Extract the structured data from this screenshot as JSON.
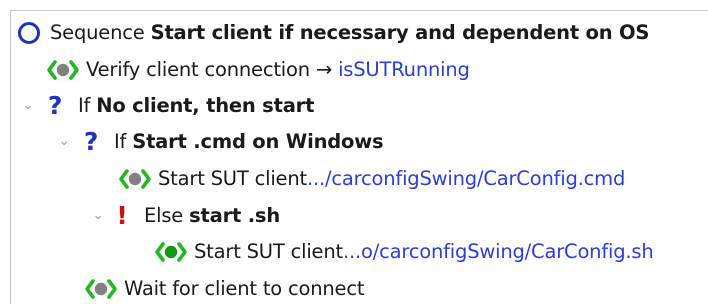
{
  "tree": {
    "nodes": [
      {
        "kind": "sequence",
        "icon": "sequence-circle-icon",
        "prefix": "Sequence ",
        "bold": "Start client if necessary and dependent on OS"
      },
      {
        "kind": "procedure-call",
        "icon": "procedure-call-icon",
        "text": "Verify client connection",
        "arrow": "→",
        "link": "isSUTRunning"
      },
      {
        "kind": "if",
        "expander": "⌄",
        "icon": "question-mark-icon",
        "icon_glyph": "?",
        "prefix": "If ",
        "bold": "No client, then start"
      },
      {
        "kind": "if",
        "expander": "⌄",
        "icon": "question-mark-icon",
        "icon_glyph": "?",
        "prefix": "If ",
        "bold": "Start .cmd on Windows"
      },
      {
        "kind": "procedure-call",
        "icon": "procedure-call-icon",
        "text": "Start SUT client ",
        "link": ".../carconfigSwing/CarConfig.cmd"
      },
      {
        "kind": "else",
        "expander": "⌄",
        "icon": "exclamation-icon",
        "icon_glyph": "!",
        "prefix": "Else ",
        "bold": "start .sh"
      },
      {
        "kind": "procedure-call",
        "icon": "procedure-call-icon",
        "text": "Start SUT client ",
        "link": "...o/carconfigSwing/CarConfig.sh"
      },
      {
        "kind": "procedure-call",
        "icon": "procedure-call-icon",
        "text": "Wait for client to connect"
      }
    ]
  },
  "colors": {
    "sequence_blue": "#1d33c7",
    "question_blue": "#1d33c7",
    "else_red": "#d01010",
    "link_blue": "#2b3fd6",
    "bracket_green": "#22b822",
    "dot_green": "#129912",
    "dot_gray": "#808080"
  }
}
